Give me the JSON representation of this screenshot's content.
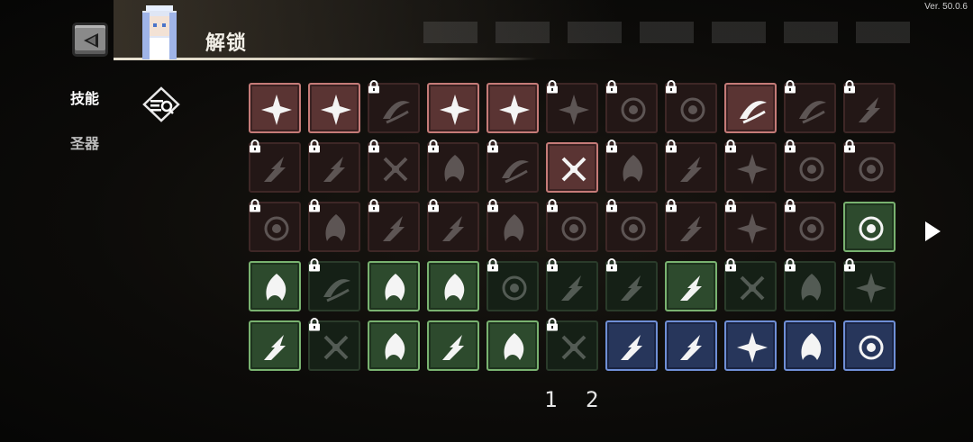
{
  "version": "Ver. 50.0.6",
  "header": {
    "title": "解锁"
  },
  "sidebar": {
    "tabs": [
      {
        "label": "技能",
        "active": true
      },
      {
        "label": "圣器",
        "active": false
      }
    ]
  },
  "grid": {
    "rows": [
      [
        {
          "color": "red",
          "locked": false,
          "icon": "slash-arc-icon"
        },
        {
          "color": "red",
          "locked": false,
          "icon": "wind-slash-icon"
        },
        {
          "color": "red",
          "locked": true,
          "icon": "thorn-bush-icon"
        },
        {
          "color": "red",
          "locked": false,
          "icon": "burst-icon"
        },
        {
          "color": "red",
          "locked": false,
          "icon": "rising-arrow-icon"
        },
        {
          "color": "red",
          "locked": true,
          "icon": "sigil-icon"
        },
        {
          "color": "red",
          "locked": true,
          "icon": "orb-icon"
        },
        {
          "color": "red",
          "locked": true,
          "icon": "lightning-ring-icon"
        },
        {
          "color": "red",
          "locked": false,
          "icon": "triple-arrow-icon"
        },
        {
          "color": "red",
          "locked": true,
          "icon": "biohazard-icon"
        },
        {
          "color": "red",
          "locked": true,
          "icon": "crescent-icon"
        }
      ],
      [
        {
          "color": "red",
          "locked": true,
          "icon": "wind-streak-icon"
        },
        {
          "color": "red",
          "locked": true,
          "icon": "claw-icon"
        },
        {
          "color": "red",
          "locked": true,
          "icon": "cross-target-icon"
        },
        {
          "color": "red",
          "locked": true,
          "icon": "frost-blade-icon"
        },
        {
          "color": "red",
          "locked": true,
          "icon": "vortex-icon"
        },
        {
          "color": "red",
          "locked": false,
          "icon": "target-ring-icon"
        },
        {
          "color": "red",
          "locked": true,
          "icon": "drill-icon"
        },
        {
          "color": "red",
          "locked": true,
          "icon": "dragon-icon"
        },
        {
          "color": "red",
          "locked": true,
          "icon": "fist-icon"
        },
        {
          "color": "red",
          "locked": true,
          "icon": "eye-icon"
        },
        {
          "color": "red",
          "locked": true,
          "icon": "feather-icon"
        }
      ],
      [
        {
          "color": "red",
          "locked": true,
          "icon": "storm-icon"
        },
        {
          "color": "red",
          "locked": true,
          "icon": "claw-slash-icon"
        },
        {
          "color": "red",
          "locked": true,
          "icon": "spear-icon"
        },
        {
          "color": "red",
          "locked": true,
          "icon": "double-slash-icon"
        },
        {
          "color": "red",
          "locked": true,
          "icon": "pulse-icon"
        },
        {
          "color": "red",
          "locked": true,
          "icon": "fireball-icon"
        },
        {
          "color": "red",
          "locked": true,
          "icon": "spikes-icon"
        },
        {
          "color": "red",
          "locked": true,
          "icon": "fangs-icon"
        },
        {
          "color": "red",
          "locked": true,
          "icon": "eruption-icon"
        },
        {
          "color": "red",
          "locked": true,
          "icon": "shuriken-icon"
        },
        {
          "color": "green",
          "locked": false,
          "icon": "fin-icon"
        }
      ],
      [
        {
          "color": "green",
          "locked": false,
          "icon": "stars-icon"
        },
        {
          "color": "green",
          "locked": true,
          "icon": "lightning-icon"
        },
        {
          "color": "green",
          "locked": false,
          "icon": "hand-icon"
        },
        {
          "color": "green",
          "locked": false,
          "icon": "spiral-flower-icon"
        },
        {
          "color": "green",
          "locked": true,
          "icon": "skull-icon"
        },
        {
          "color": "green",
          "locked": true,
          "icon": "toxic-icon"
        },
        {
          "color": "green",
          "locked": true,
          "icon": "sword-icon"
        },
        {
          "color": "green",
          "locked": false,
          "icon": "flame-icon"
        },
        {
          "color": "green",
          "locked": true,
          "icon": "axe-icon"
        },
        {
          "color": "green",
          "locked": true,
          "icon": "daggers-icon"
        },
        {
          "color": "green",
          "locked": true,
          "icon": "web-icon"
        }
      ],
      [
        {
          "color": "green",
          "locked": false,
          "icon": "sparkles-icon"
        },
        {
          "color": "green",
          "locked": true,
          "icon": "leaf-icon"
        },
        {
          "color": "green",
          "locked": false,
          "icon": "cyclone-icon"
        },
        {
          "color": "green",
          "locked": false,
          "icon": "slashes-icon"
        },
        {
          "color": "green",
          "locked": false,
          "icon": "splash-icon"
        },
        {
          "color": "green",
          "locked": true,
          "icon": "gauntlet-icon"
        },
        {
          "color": "blue",
          "locked": false,
          "icon": "ball-icon"
        },
        {
          "color": "blue",
          "locked": false,
          "icon": "ghost-icon"
        },
        {
          "color": "blue",
          "locked": false,
          "icon": "hourglass-icon"
        },
        {
          "color": "blue",
          "locked": false,
          "icon": "climb-icon"
        },
        {
          "color": "blue",
          "locked": false,
          "icon": "climb-up-icon"
        }
      ]
    ]
  },
  "pagination": {
    "pages": [
      "1",
      "2"
    ]
  },
  "icons": {
    "back": "back-arrow-icon",
    "filter": "filter-search-icon",
    "next": "next-page-icon",
    "lock": "lock-icon"
  },
  "colors": {
    "red_border": "#c57b78",
    "green_border": "#79b270",
    "blue_border": "#6f8fd6"
  }
}
